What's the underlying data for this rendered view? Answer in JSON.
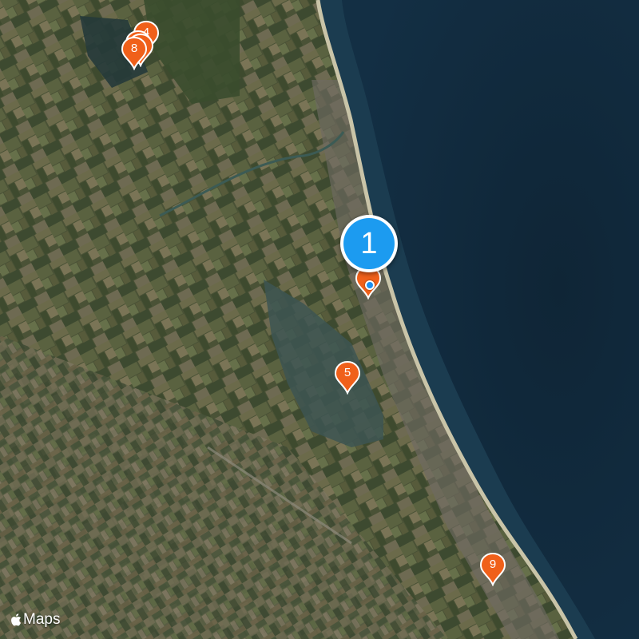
{
  "map": {
    "type": "satellite",
    "colors": {
      "sea": "#10283c",
      "shallow_water": "#1d3e52",
      "land": "#4b5236",
      "beach": "#c9c4a8",
      "pin": "#f0601a",
      "cluster": "#1c9bf0"
    }
  },
  "cluster": {
    "count": "1",
    "icon": "cluster-marker"
  },
  "pins": [
    {
      "id": "pin-4",
      "number": "4",
      "icon": "map-pin"
    },
    {
      "id": "pin-8",
      "number": "8",
      "icon": "map-pin"
    },
    {
      "id": "pin-5",
      "number": "5",
      "icon": "map-pin"
    },
    {
      "id": "pin-9",
      "number": "9",
      "icon": "map-pin"
    }
  ],
  "attribution": {
    "text": "Maps",
    "icon": "apple-logo-icon"
  }
}
